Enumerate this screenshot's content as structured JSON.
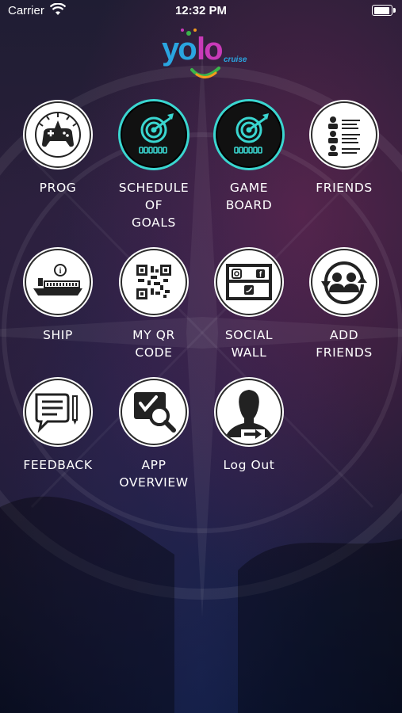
{
  "status_bar": {
    "carrier": "Carrier",
    "time": "12:32 PM",
    "battery_level": 0.95
  },
  "logo": {
    "part1": "yo",
    "part2": "lo",
    "sub": "cruise",
    "colors": {
      "blue": "#2aa5e0",
      "magenta": "#c93ab8",
      "green": "#3bb54a",
      "orange": "#f29b1d"
    }
  },
  "menu": {
    "items": [
      {
        "id": "prog",
        "icon": "gamepad-icon",
        "label_lines": [
          "PROG"
        ]
      },
      {
        "id": "schedule",
        "icon": "target-icon",
        "label_lines": [
          "SCHEDULE",
          "OF",
          "GOALS"
        ]
      },
      {
        "id": "gameboard",
        "icon": "target-icon",
        "label_lines": [
          "GAME",
          "BOARD"
        ]
      },
      {
        "id": "friends",
        "icon": "people-list-icon",
        "label_lines": [
          "FRIENDS"
        ]
      },
      {
        "id": "ship",
        "icon": "ship-icon",
        "label_lines": [
          "SHIP"
        ]
      },
      {
        "id": "qr",
        "icon": "qr-code-icon",
        "label_lines": [
          "MY QR",
          "CODE"
        ]
      },
      {
        "id": "social",
        "icon": "social-wall-icon",
        "label_lines": [
          "SOCIAL",
          "WALL"
        ]
      },
      {
        "id": "addfriends",
        "icon": "add-friends-icon",
        "label_lines": [
          "ADD",
          "FRIENDS"
        ]
      },
      {
        "id": "feedback",
        "icon": "feedback-icon",
        "label_lines": [
          "FEEDBACK"
        ]
      },
      {
        "id": "overview",
        "icon": "app-overview-icon",
        "label_lines": [
          "APP",
          "OVERVIEW"
        ]
      },
      {
        "id": "logout",
        "icon": "logout-icon",
        "label_lines": [
          "Log Out"
        ]
      }
    ]
  },
  "theme": {
    "accent_teal": "#3ad6d0"
  }
}
